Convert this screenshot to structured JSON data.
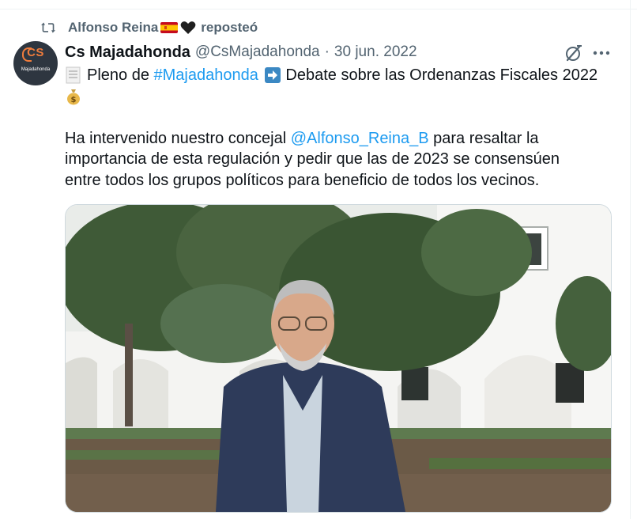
{
  "repost": {
    "user": "Alfonso Reina",
    "label": "reposteó"
  },
  "tweet": {
    "display_name": "Cs Majadahonda",
    "handle": "@CsMajadahonda",
    "separator": "·",
    "date": "30 jun. 2022",
    "avatar_text": "CS",
    "avatar_subtext": "Majadahonda",
    "line1_a": "Pleno de ",
    "hashtag": "#Majadahonda",
    "line1_b": " Debate sobre las Ordenanzas Fiscales 2022",
    "para2_a": "Ha intervenido nuestro concejal ",
    "mention": "@Alfonso_Reina_B",
    "para2_b": " para resaltar la",
    "para2_line2": "importancia de esta regulación y pedir que las de 2023 se consensúen",
    "para2_line3": "entre todos los grupos políticos para beneficio de todos los vecinos."
  },
  "icons": {
    "repost": "repost-icon",
    "flag": "spain-flag-icon",
    "heart": "black-heart-icon",
    "document": "page-facing-up-icon",
    "arrow": "right-arrow-icon",
    "money": "money-bag-icon",
    "grok": "grok-icon",
    "more": "more-icon"
  },
  "colors": {
    "link": "#1d9bf0",
    "secondary_text": "#536471",
    "text": "#0f1419"
  }
}
